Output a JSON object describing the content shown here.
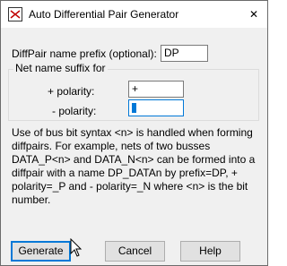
{
  "window": {
    "title": "Auto Differential Pair Generator",
    "icon": "app-icon",
    "close_glyph": "✕"
  },
  "form": {
    "prefix_label": "DiffPair name prefix (optional):",
    "prefix_value": "DP",
    "group_title": "Net name suffix for",
    "plus_label": "+ polarity:",
    "plus_value": "+",
    "minus_label": "- polarity:",
    "minus_value": ""
  },
  "description": "Use of bus bit syntax <n> is handled when forming diffpairs. For example, nets of two busses DATA_P<n> and DATA_N<n> can be formed into a diffpair with a name DP_DATAn by prefix=DP, + polarity=_P and - polarity=_N where <n> is the bit number.",
  "buttons": {
    "generate": "Generate",
    "cancel": "Cancel",
    "help": "Help"
  },
  "colors": {
    "accent": "#0078d7",
    "dialog_bg": "#f0f0f0"
  }
}
